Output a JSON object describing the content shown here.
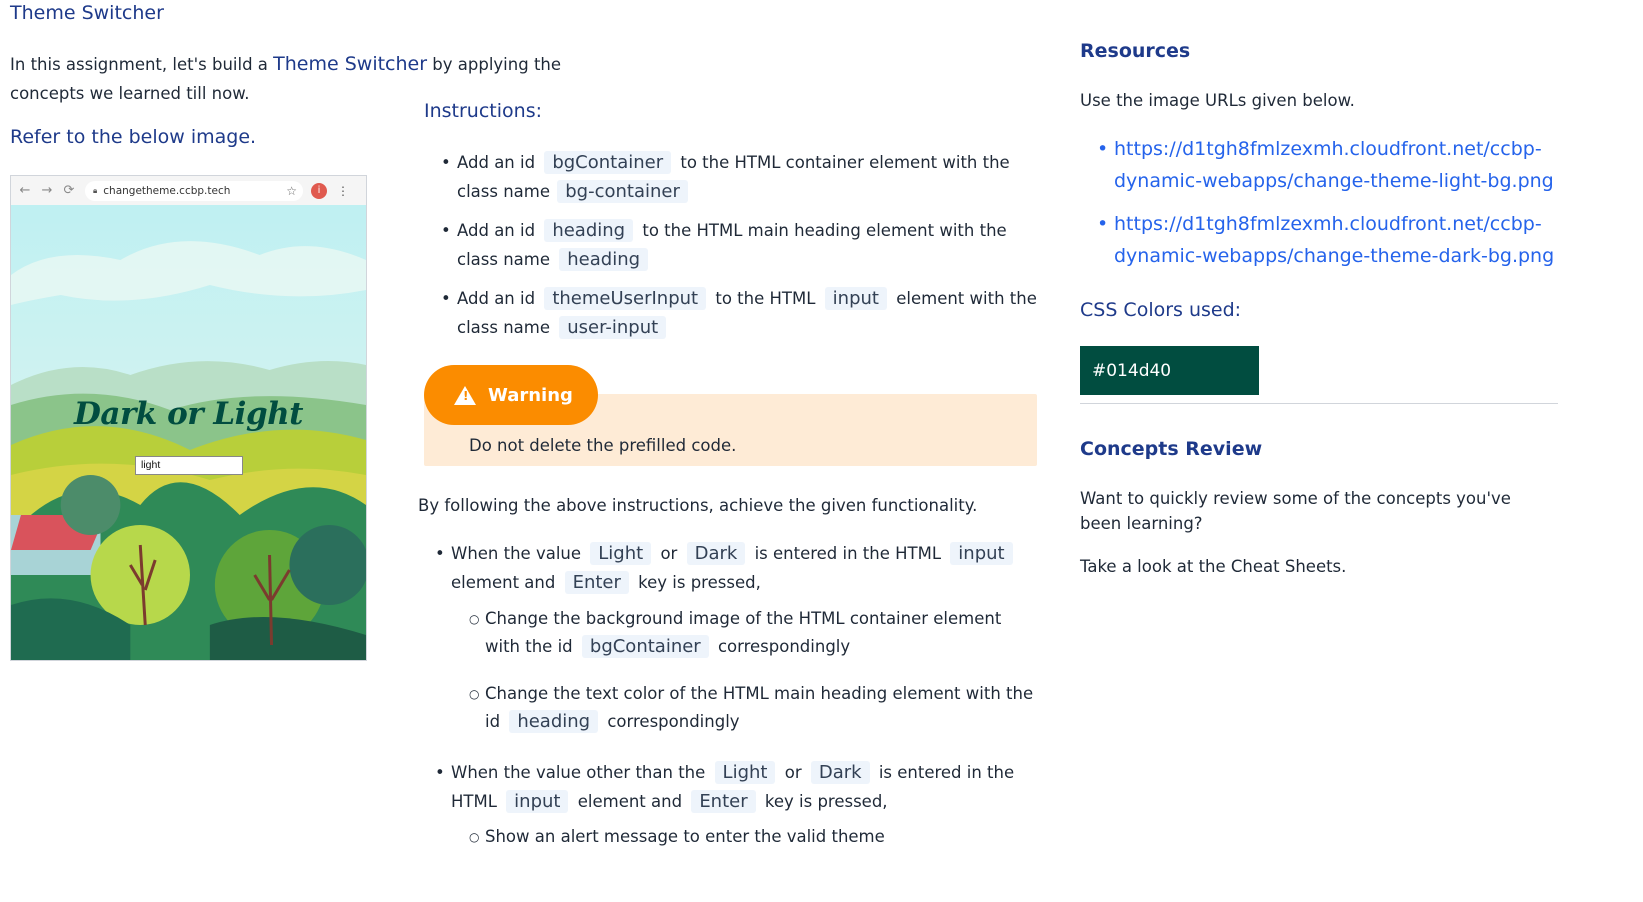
{
  "page": {
    "title": "Theme Switcher",
    "intro_before": "In this assignment, let's build a ",
    "intro_highlight": "Theme Switcher",
    "intro_after": " by applying the concepts we learned till now.",
    "refer": "Refer to the below image."
  },
  "mockup": {
    "url": "changetheme.ccbp.tech",
    "heading": "Dark or Light",
    "input_value": "light"
  },
  "instructions": {
    "heading": "Instructions:",
    "items": [
      {
        "pre": "Add an id",
        "code1": "bgContainer",
        "mid": "to the HTML container element with the class name",
        "code2": "bg-container"
      },
      {
        "pre": "Add an id",
        "code1": "heading",
        "mid": "to the HTML main heading element with the class name",
        "code2": "heading"
      },
      {
        "pre": "Add an id",
        "code1": "themeUserInput",
        "mid": "to the HTML",
        "code_mid": "input",
        "mid2": "element with the class name",
        "code2": "user-input"
      }
    ]
  },
  "warning": {
    "label": "Warning",
    "text": "Do not delete the prefilled code."
  },
  "functionality": {
    "intro": "By following the above instructions, achieve the given functionality.",
    "case1": {
      "t1": "When the value",
      "c1": "Light",
      "t2": "or",
      "c2": "Dark",
      "t3": "is entered in the HTML",
      "c3": "input",
      "t4": "element and",
      "c4": "Enter",
      "t5": "key is pressed,",
      "sub1_a": "Change the background image of the HTML container element with the id",
      "sub1_code": "bgContainer",
      "sub1_b": "correspondingly",
      "sub2_a": "Change the text color of the HTML main heading element with the id",
      "sub2_code": "heading",
      "sub2_b": "correspondingly"
    },
    "case2": {
      "t1": "When the value other than the",
      "c1": "Light",
      "t2": "or",
      "c2": "Dark",
      "t3": "is entered in the",
      "t4": "HTML",
      "c3": "input",
      "t5": "element and",
      "c4": "Enter",
      "t6": "key is pressed,",
      "sub1": "Show an alert message to enter the valid theme"
    }
  },
  "resources": {
    "heading": "Resources",
    "text": "Use the image URLs given below.",
    "links": [
      {
        "line1": "https://d1tgh8fmlzexmh.cloudfront.net/ccbp-",
        "line2": "dynamic-webapps/change-theme-light-bg.png"
      },
      {
        "line1": "https://d1tgh8fmlzexmh.cloudfront.net/ccbp-",
        "line2": "dynamic-webapps/change-theme-dark-bg.png"
      }
    ]
  },
  "css_colors": {
    "heading": "CSS Colors used:",
    "swatch": "#014d40"
  },
  "concepts": {
    "heading": "Concepts Review",
    "text": "Want to quickly review some of the concepts you've been learning?",
    "cheat": "Take a look at the Cheat Sheets."
  }
}
